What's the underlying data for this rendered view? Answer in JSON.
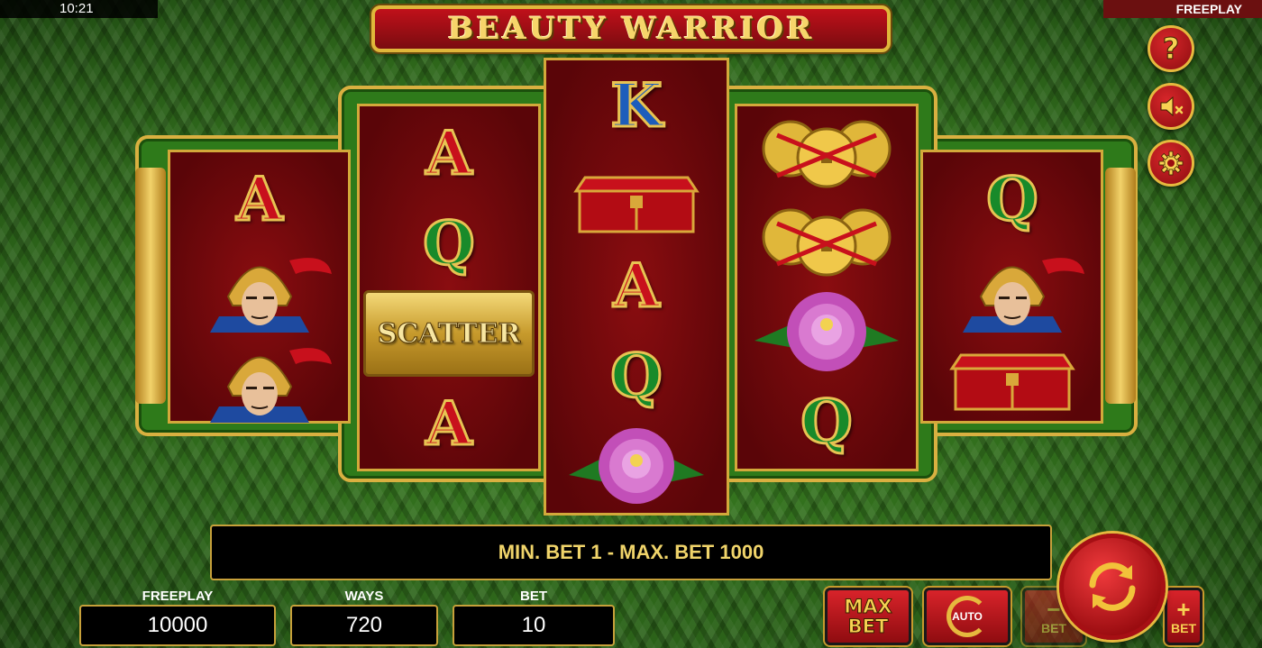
{
  "status": {
    "clock": "10:21",
    "mode": "FREEPLAY"
  },
  "title": "BEAUTY WARRIOR",
  "side_buttons": {
    "help": "?",
    "sound_icon": "speaker-muted-icon",
    "settings_icon": "gear-icon"
  },
  "reels": [
    [
      "A",
      "warrior",
      "warrior"
    ],
    [
      "A",
      "Q",
      "SCATTER",
      "A"
    ],
    [
      "K",
      "chest",
      "A",
      "Q",
      "peony"
    ],
    [
      "coins",
      "coins",
      "peony",
      "Q"
    ],
    [
      "Q",
      "warrior",
      "chest"
    ]
  ],
  "info_message": "MIN. BET 1 - MAX. BET 1000",
  "stats": {
    "freeplay_label": "FREEPLAY",
    "freeplay_value": "10000",
    "ways_label": "WAYS",
    "ways_value": "720",
    "bet_label": "BET",
    "bet_value": "10"
  },
  "controls": {
    "maxbet_line1": "MAX",
    "maxbet_line2": "BET",
    "auto_label": "AUTO",
    "betminus_sign": "−",
    "betminus_label": "BET",
    "betplus_sign": "+",
    "betplus_label": "BET"
  },
  "colors": {
    "accent_gold": "#e6b93e",
    "button_red": "#c8101c",
    "felt_green": "#2f6a1c"
  }
}
